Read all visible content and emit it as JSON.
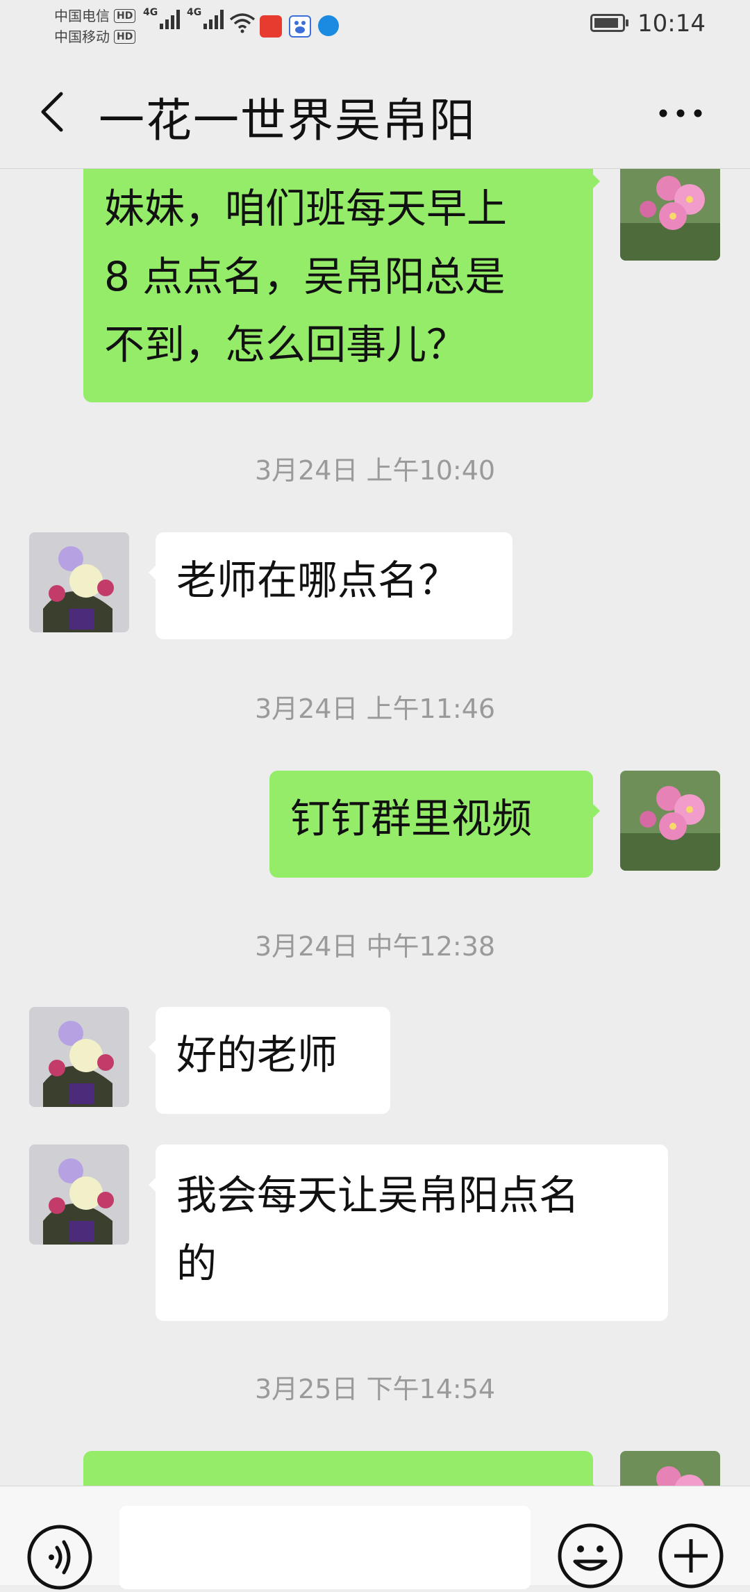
{
  "status_bar": {
    "carrier1": "中国电信",
    "carrier2": "中国移动",
    "hd_label": "HD",
    "network1": "4G",
    "network2": "4G",
    "time": "10:14",
    "app_icons": [
      "toutiao-icon",
      "baidu-icon",
      "browser-icon"
    ]
  },
  "header": {
    "title": "一花一世界吴帛阳"
  },
  "messages": [
    {
      "side": "me",
      "text_lines": [
        "妹妹，咱们班每天早上",
        "8 点点名，吴帛阳总是",
        "不到，怎么回事儿？"
      ]
    },
    {
      "type": "time",
      "text": "3月24日 上午10:40"
    },
    {
      "side": "them",
      "text_lines": [
        "老师在哪点名？"
      ]
    },
    {
      "type": "time",
      "text": "3月24日 上午11:46"
    },
    {
      "side": "me",
      "text_lines": [
        "钉钉群里视频"
      ]
    },
    {
      "type": "time",
      "text": "3月24日 中午12:38"
    },
    {
      "side": "them",
      "text_lines": [
        "好的老师"
      ]
    },
    {
      "side": "them",
      "text_lines": [
        "我会每天让吴帛阳点名",
        "的"
      ]
    },
    {
      "type": "time",
      "text": "3月25日 下午14:54"
    },
    {
      "side": "me",
      "text_lines": [
        ""
      ]
    }
  ],
  "colors": {
    "background": "#ededed",
    "my_bubble": "#95ec69",
    "their_bubble": "#ffffff",
    "timestamp": "#9a9a9a"
  }
}
